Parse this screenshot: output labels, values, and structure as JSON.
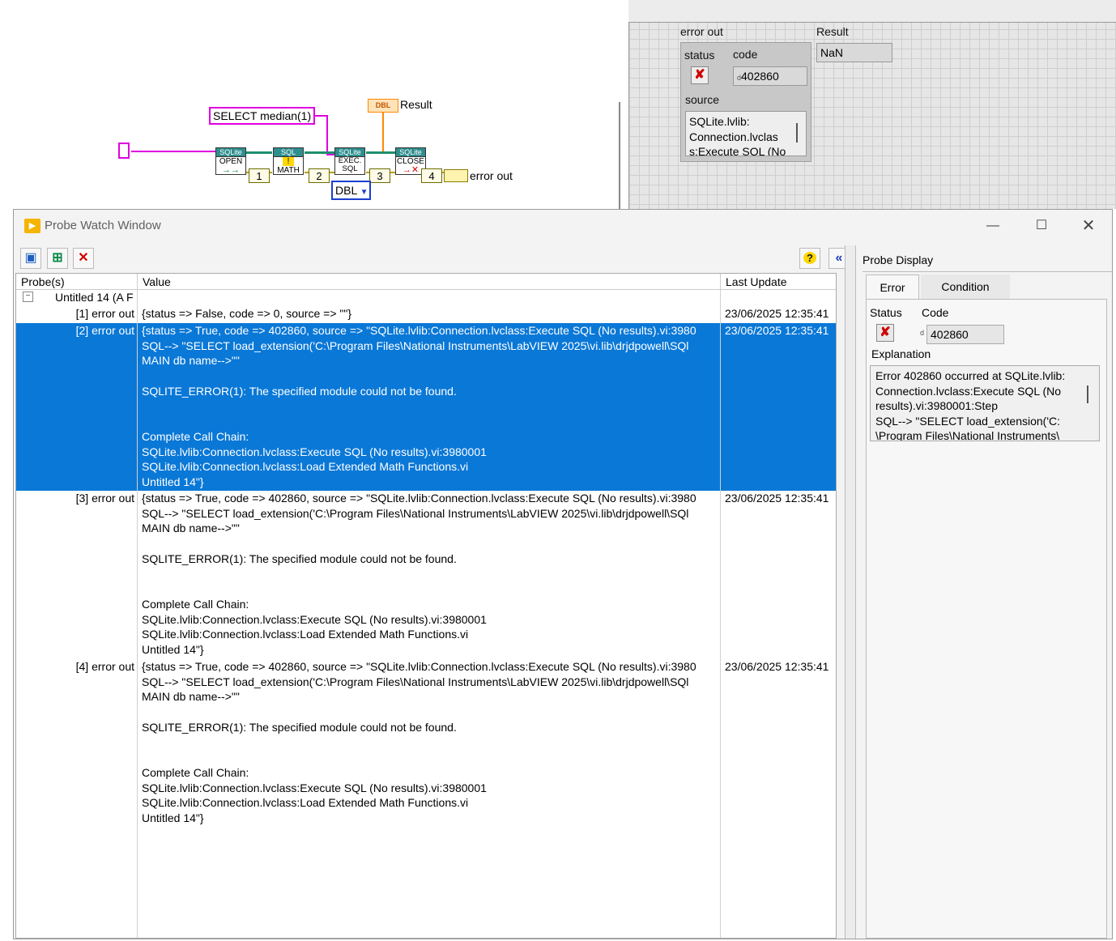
{
  "diagram": {
    "sql_constant": "SELECT median(1)",
    "open_vi": {
      "header": "SQLite",
      "label": "OPEN"
    },
    "math_vi": {
      "header": "SQL",
      "label": "MATH"
    },
    "exec_vi": {
      "header": "SQLite",
      "label": "EXEC. SQL"
    },
    "close_vi": {
      "header": "SQLite",
      "label": "CLOSE"
    },
    "probe_numbers": [
      "1",
      "2",
      "3",
      "4"
    ],
    "result_terminal": "DBL",
    "result_label": "Result",
    "error_out_label": "error out",
    "type_selector": "DBL"
  },
  "panel": {
    "error_out_label": "error out",
    "status_label": "status",
    "code_label": "code",
    "code_value": "402860",
    "source_label": "source",
    "source_value": "SQLite.lvlib:\nConnection.lvclas\ns:Execute SQL (No",
    "result_label": "Result",
    "result_value": "NaN"
  },
  "probe_window": {
    "title": "Probe Watch Window",
    "columns": {
      "probes": "Probe(s)",
      "value": "Value",
      "last_update": "Last Update"
    },
    "group_label": "Untitled 14 (A F",
    "rows": [
      {
        "name": "[1] error out",
        "value": "{status => False, code => 0, source => \"\"}",
        "updated": "23/06/2025 12:35:41"
      },
      {
        "name": "[2] error out",
        "value": "{status => True, code => 402860, source => \"SQLite.lvlib:Connection.lvclass:Execute SQL (No results).vi:3980\nSQL--> \"SELECT load_extension('C:\\Program Files\\National Instruments\\LabVIEW 2025\\vi.lib\\drjdpowell\\SQl\nMAIN db name-->\"\"\n\nSQLITE_ERROR(1): The specified module could not be found.\n\n\nComplete Call Chain:\nSQLite.lvlib:Connection.lvclass:Execute SQL (No results).vi:3980001\nSQLite.lvlib:Connection.lvclass:Load Extended Math Functions.vi\nUntitled 14\"}",
        "updated": "23/06/2025 12:35:41"
      },
      {
        "name": "[3] error out",
        "value": "{status => True, code => 402860, source => \"SQLite.lvlib:Connection.lvclass:Execute SQL (No results).vi:3980\nSQL--> \"SELECT load_extension('C:\\Program Files\\National Instruments\\LabVIEW 2025\\vi.lib\\drjdpowell\\SQl\nMAIN db name-->\"\"\n\nSQLITE_ERROR(1): The specified module could not be found.\n\n\nComplete Call Chain:\nSQLite.lvlib:Connection.lvclass:Execute SQL (No results).vi:3980001\nSQLite.lvlib:Connection.lvclass:Load Extended Math Functions.vi\nUntitled 14\"}",
        "updated": "23/06/2025 12:35:41"
      },
      {
        "name": "[4] error out",
        "value": "{status => True, code => 402860, source => \"SQLite.lvlib:Connection.lvclass:Execute SQL (No results).vi:3980\nSQL--> \"SELECT load_extension('C:\\Program Files\\National Instruments\\LabVIEW 2025\\vi.lib\\drjdpowell\\SQl\nMAIN db name-->\"\"\n\nSQLITE_ERROR(1): The specified module could not be found.\n\n\nComplete Call Chain:\nSQLite.lvlib:Connection.lvclass:Execute SQL (No results).vi:3980001\nSQLite.lvlib:Connection.lvclass:Load Extended Math Functions.vi\nUntitled 14\"}",
        "updated": "23/06/2025 12:35:41"
      }
    ],
    "display": {
      "title": "Probe Display",
      "tabs": [
        "Error",
        "Condition"
      ],
      "status_label": "Status",
      "code_label": "Code",
      "code_value": "402860",
      "explanation_label": "Explanation",
      "explanation": "Error 402860 occurred at SQLite.lvlib:\nConnection.lvclass:Execute SQL (No\nresults).vi:3980001:Step\nSQL--> \"SELECT load_extension('C:\n\\Program Files\\National Instruments\\"
    }
  },
  "colors": {
    "selection": "#0a78d7",
    "constant_border": "#e000e0",
    "error_wire": "#b8a000",
    "class_wire": "#1f8f6f",
    "double_wire": "#ff8800"
  }
}
